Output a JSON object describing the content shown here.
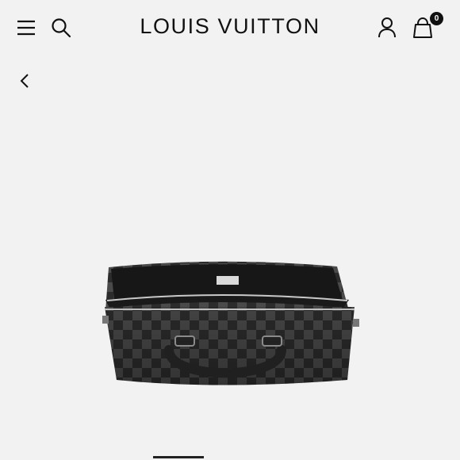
{
  "header": {
    "brand": "LOUIS VUITTON",
    "cart_count": "0"
  },
  "icons": {
    "menu": "menu-icon",
    "search": "search-icon",
    "account": "user-icon",
    "bag": "shopping-bag-icon",
    "back": "chevron-left-icon"
  },
  "product": {
    "image": "black-damier-graphite-briefcase"
  },
  "carousel": {
    "progress": 0.2
  },
  "colors": {
    "background": "#f2f2f2",
    "text": "#111111"
  }
}
